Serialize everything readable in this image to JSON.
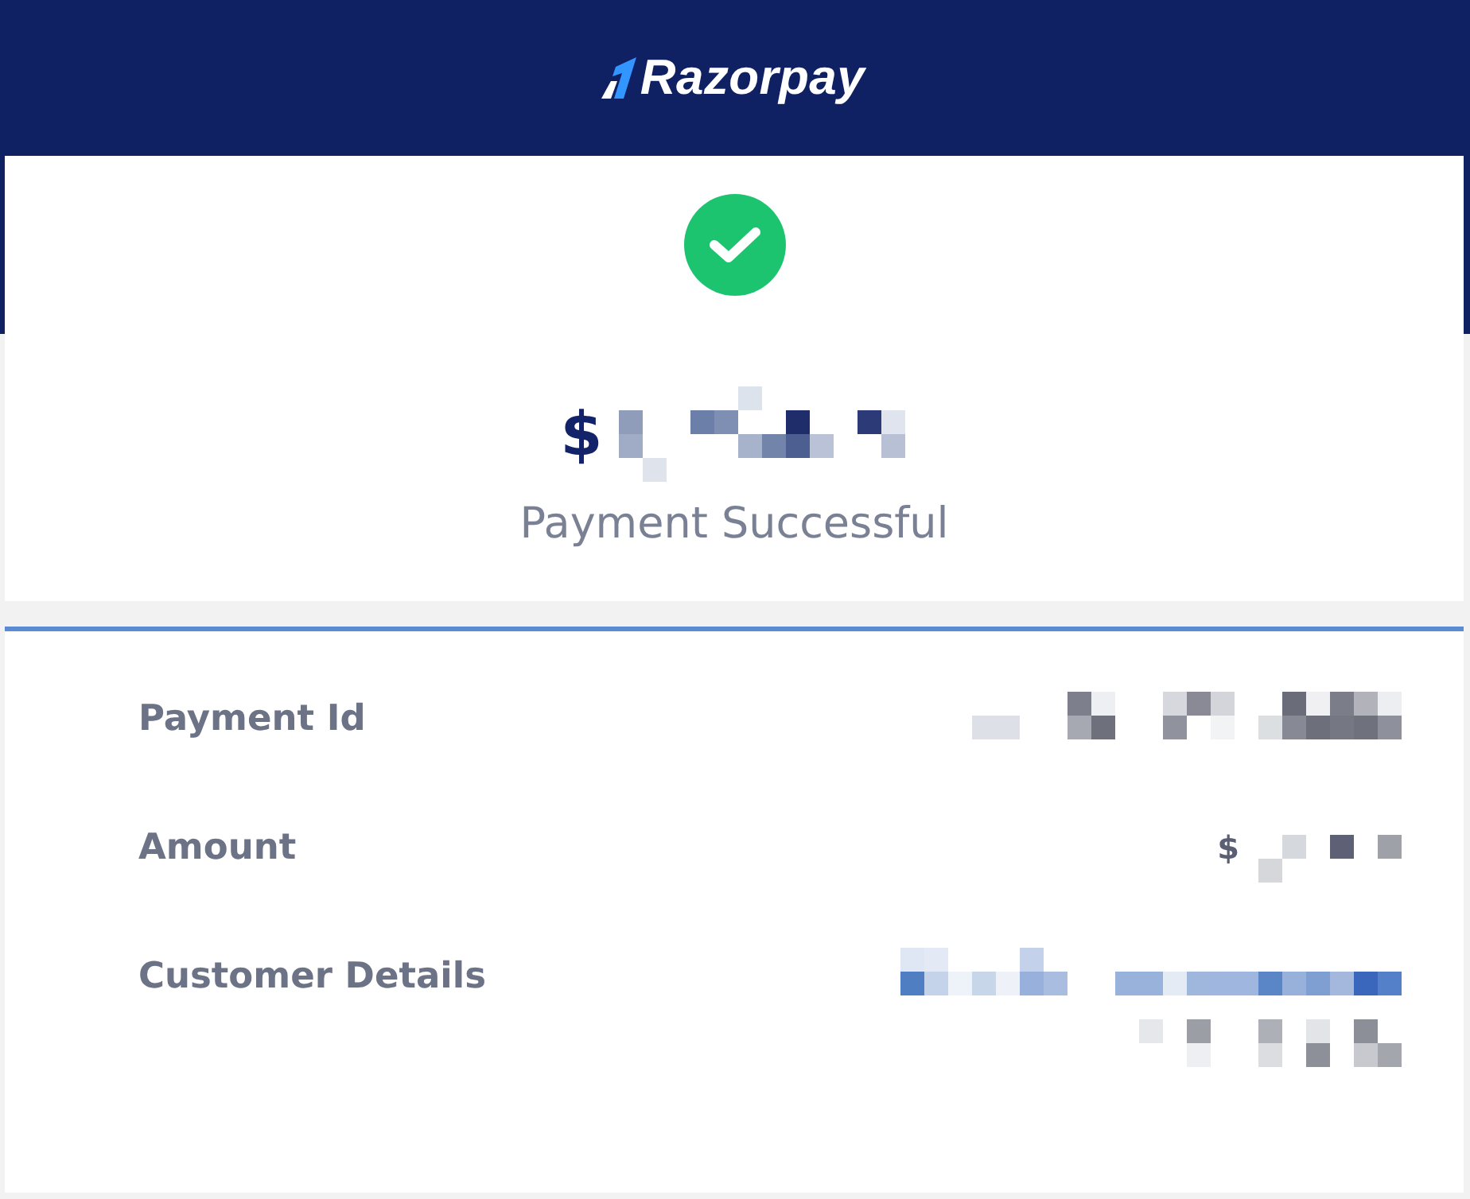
{
  "header": {
    "brand": "Razorpay"
  },
  "status": {
    "kind": "success"
  },
  "amount": {
    "currency": "$",
    "redacted": true
  },
  "message": "Payment Successful",
  "details": [
    {
      "label": "Payment Id",
      "value": {
        "redacted": true
      }
    },
    {
      "label": "Amount",
      "value": {
        "currency": "$",
        "redacted": true
      }
    },
    {
      "label": "Customer Details",
      "value": {
        "redacted": true
      }
    }
  ]
}
